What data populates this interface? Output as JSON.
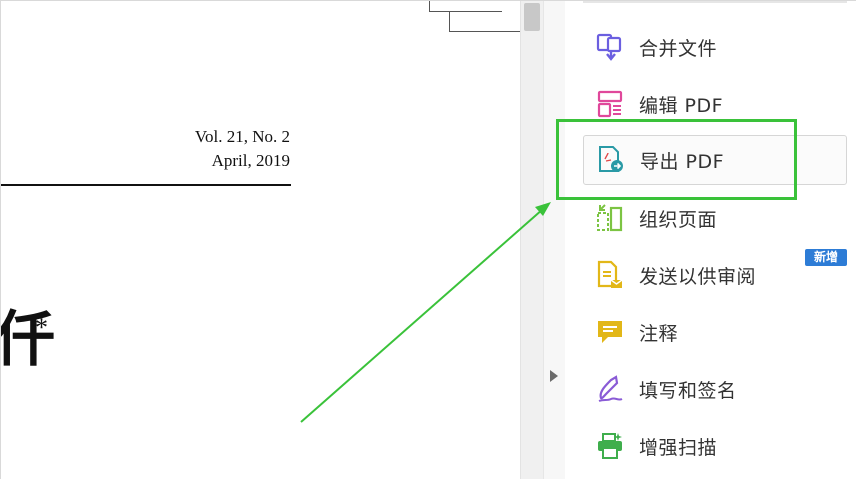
{
  "document": {
    "meta_line1": "Vol. 21, No. 2",
    "meta_line2": "April, 2019",
    "title_fragment": "仟",
    "footnote_mark": "*"
  },
  "tools_panel": {
    "items": [
      {
        "label": "合并文件",
        "icon": "combine-files-icon",
        "color": "#6b5fe0"
      },
      {
        "label": "编辑 PDF",
        "icon": "edit-pdf-icon",
        "color": "#e0489b"
      },
      {
        "label": "导出 PDF",
        "icon": "export-pdf-icon",
        "color": "#2a9aa6",
        "selected": true
      },
      {
        "label": "组织页面",
        "icon": "organize-pages-icon",
        "color": "#7cc443"
      },
      {
        "label": "发送以供审阅",
        "icon": "send-for-review-icon",
        "color": "#e2b718",
        "badge": "新增"
      },
      {
        "label": "注释",
        "icon": "comment-icon",
        "color": "#e2b718"
      },
      {
        "label": "填写和签名",
        "icon": "fill-sign-icon",
        "color": "#8a5bd6"
      },
      {
        "label": "增强扫描",
        "icon": "enhance-scan-icon",
        "color": "#3fae4c"
      }
    ]
  },
  "annotation": {
    "highlight_color": "#3ac23a"
  }
}
